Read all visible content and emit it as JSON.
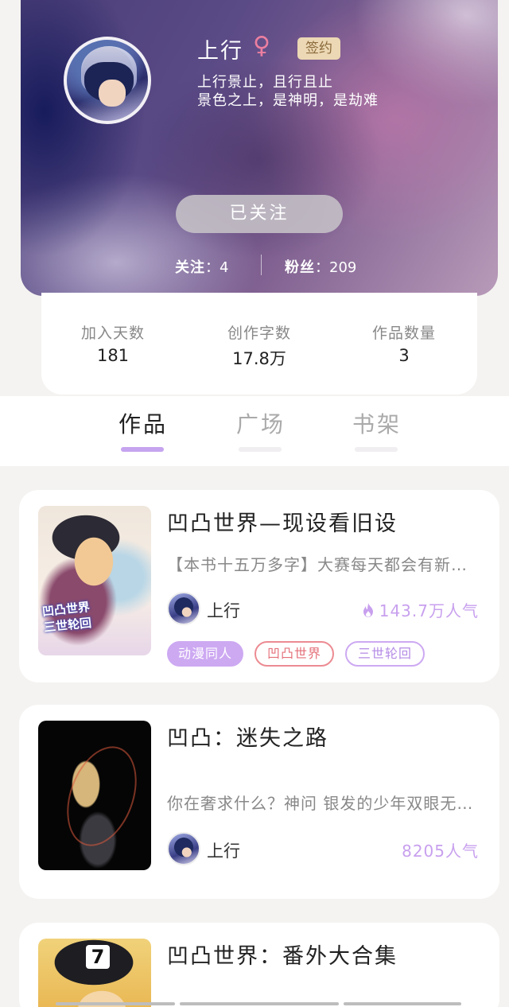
{
  "profile": {
    "name": "上行",
    "gender_icon": "female-symbol-icon",
    "gender_glyph": "♀",
    "badge": "签约",
    "bio_line1": "上行景止，且行且止",
    "bio_line2": "景色之上，是神明，是劫难",
    "follow_button": "已关注",
    "following_label": "关注",
    "following_count": "：4",
    "fans_label": "粉丝",
    "fans_count": "：209"
  },
  "stats": [
    {
      "label": "加入天数",
      "value": "181"
    },
    {
      "label": "创作字数",
      "value": "17.8万"
    },
    {
      "label": "作品数量",
      "value": "3"
    }
  ],
  "tabs": [
    {
      "label": "作品",
      "active": true
    },
    {
      "label": "广场",
      "active": false
    },
    {
      "label": "书架",
      "active": false
    }
  ],
  "books": [
    {
      "title": "凹凸世界—现设看旧设",
      "description": "【本书十五万多字】大赛每天都会有新…",
      "author": "上行",
      "popularity": "143.7万人气",
      "popularity_icon": "flame-icon",
      "cover_text_1": "凹凸世界",
      "cover_text_2": "三世轮回",
      "tags": [
        "动漫同人",
        "凹凸世界",
        "三世轮回"
      ]
    },
    {
      "title": "凹凸：迷失之路",
      "description": "你在奢求什么？神问 银发的少年双眼无…",
      "author": "上行",
      "popularity": "8205人气"
    },
    {
      "title": "凹凸世界：番外大合集"
    }
  ],
  "colors": {
    "accent": "#c6a4ef",
    "badge_bg": "#ecd8b4",
    "tag_red": "#ec8b92",
    "gender": "#ec7fa0"
  }
}
